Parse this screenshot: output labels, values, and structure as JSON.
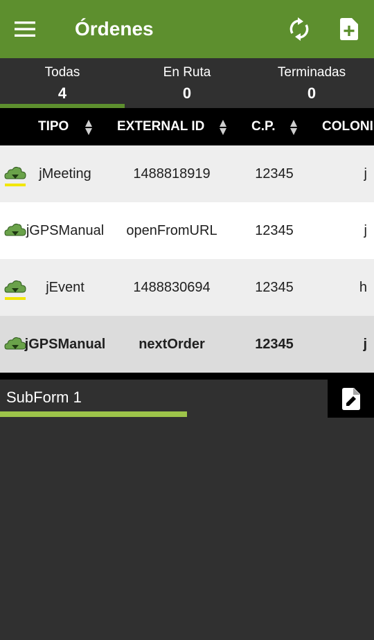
{
  "app": {
    "title": "Órdenes",
    "colors": {
      "appbar": "#5d8f2e",
      "tab_indicator": "#5d8f2e",
      "subform_bar": "#9dc44a",
      "underline": "#f2e600"
    },
    "icons": {
      "menu": "menu-icon",
      "refresh": "refresh-icon",
      "add": "add-file-icon",
      "edit": "edit-file-icon",
      "row": "cloud-icon"
    }
  },
  "tabs": [
    {
      "label": "Todas",
      "count": "4",
      "selected": true
    },
    {
      "label": "En Ruta",
      "count": "0",
      "selected": false
    },
    {
      "label": "Terminadas",
      "count": "0",
      "selected": false
    }
  ],
  "table": {
    "headers": [
      "TIPO",
      "EXTERNAL ID",
      "C.P.",
      "COLONI"
    ],
    "rows": [
      {
        "tipo": "jMeeting",
        "external_id": "1488818919",
        "cp": "12345",
        "colonia": "j",
        "marked": true,
        "selected": false
      },
      {
        "tipo": "jGPSManual",
        "external_id": "openFromURL",
        "cp": "12345",
        "colonia": "j",
        "marked": false,
        "selected": false
      },
      {
        "tipo": "jEvent",
        "external_id": "1488830694",
        "cp": "12345",
        "colonia": "h",
        "marked": true,
        "selected": false
      },
      {
        "tipo": "jGPSManual",
        "external_id": "nextOrder",
        "cp": "12345",
        "colonia": "j",
        "marked": false,
        "selected": true
      }
    ]
  },
  "subform": {
    "label": "SubForm 1"
  }
}
